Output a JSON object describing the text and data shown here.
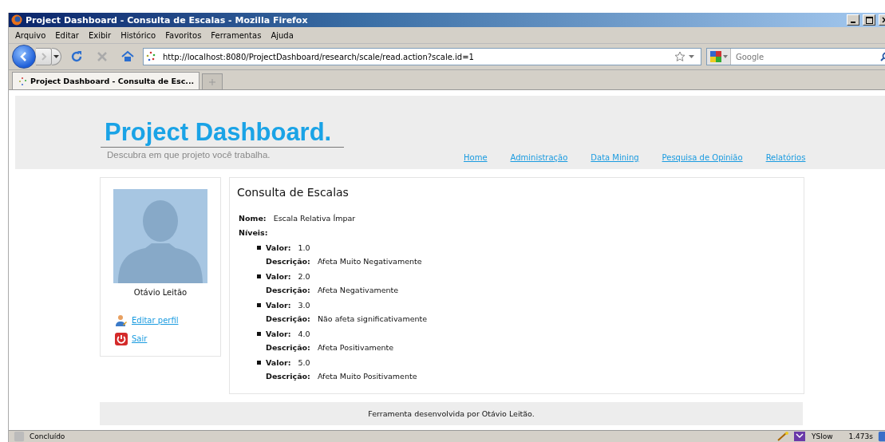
{
  "window": {
    "title": "Project Dashboard - Consulta de Escalas - Mozilla Firefox"
  },
  "menu": [
    "Arquivo",
    "Editar",
    "Exibir",
    "Histórico",
    "Favoritos",
    "Ferramentas",
    "Ajuda"
  ],
  "address": {
    "value": "http://localhost:8080/ProjectDashboard/research/scale/read.action?scale.id=1"
  },
  "search": {
    "placeholder": "Google"
  },
  "tabs": [
    {
      "label": "Project Dashboard - Consulta de Esc...",
      "selected": true
    }
  ],
  "header": {
    "logo": "Project Dashboard.",
    "tagline": "Descubra em que projeto você trabalha.",
    "nav": [
      "Home",
      "Administração",
      "Data Mining",
      "Pesquisa de Opinião",
      "Relatórios"
    ]
  },
  "sidebar": {
    "user": "Otávio Leitão",
    "links": [
      {
        "kind": "edit",
        "label": "Editar perfil"
      },
      {
        "kind": "logout",
        "label": "Sair"
      }
    ]
  },
  "main": {
    "title": "Consulta de Escalas",
    "name_label": "Nome:",
    "name": "Escala Relativa Ímpar",
    "levels_label": "Níveis:",
    "levels": [
      {
        "value_label": "Valor:",
        "value": "1.0",
        "desc_label": "Descrição:",
        "desc": "Afeta Muito Negativamente"
      },
      {
        "value_label": "Valor:",
        "value": "2.0",
        "desc_label": "Descrição:",
        "desc": "Afeta Negativamente"
      },
      {
        "value_label": "Valor:",
        "value": "3.0",
        "desc_label": "Descrição:",
        "desc": "Não afeta significativamente"
      },
      {
        "value_label": "Valor:",
        "value": "4.0",
        "desc_label": "Descrição:",
        "desc": "Afeta Positivamente"
      },
      {
        "value_label": "Valor:",
        "value": "5.0",
        "desc_label": "Descrição:",
        "desc": "Afeta Muito Positivamente"
      }
    ]
  },
  "footer": "Ferramenta desenvolvida por Otávio Leitão.",
  "status_bar": {
    "text": "Concluído",
    "addon": "YSlow",
    "time": "1.473s"
  }
}
